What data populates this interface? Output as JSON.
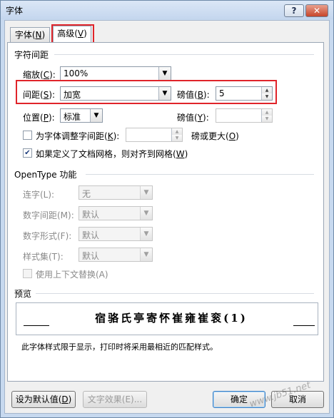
{
  "window": {
    "title": "字体",
    "help_label": "?",
    "close_label": "✕"
  },
  "tabs": [
    {
      "label": "字体(",
      "key": "N",
      "suffix": ")"
    },
    {
      "label": "高级(",
      "key": "V",
      "suffix": ")"
    }
  ],
  "spacing": {
    "section_title": "字符间距",
    "scale": {
      "label": "缩放(",
      "key": "C",
      "suffix": "):",
      "value": "100%"
    },
    "spacing": {
      "label": "间距(",
      "key": "S",
      "suffix": "):",
      "value": "加宽"
    },
    "spacing_by": {
      "label": "磅值(",
      "key": "B",
      "suffix": "):",
      "value": "5"
    },
    "position": {
      "label": "位置(",
      "key": "P",
      "suffix": "):",
      "value": "标准"
    },
    "position_by": {
      "label": "磅值(",
      "key": "Y",
      "suffix": "):",
      "value": ""
    },
    "kerning": {
      "label": "为字体调整字间距(",
      "key": "K",
      "suffix": "):",
      "value": "",
      "after_label": "磅或更大(",
      "after_key": "O",
      "after_suffix": ")",
      "checked": false
    },
    "snap_grid": {
      "label": "如果定义了文档网格，则对齐到网格(",
      "key": "W",
      "suffix": ")",
      "checked": true
    }
  },
  "opentype": {
    "section_title": "OpenType 功能",
    "ligatures": {
      "label": "连字(L):",
      "value": "无"
    },
    "number_spacing": {
      "label": "数字间距(M):",
      "value": "默认"
    },
    "number_forms": {
      "label": "数字形式(F):",
      "value": "默认"
    },
    "stylistic_sets": {
      "label": "样式集(T):",
      "value": "默认"
    },
    "contextual": {
      "label": "使用上下文替换(A)",
      "checked": false
    }
  },
  "preview": {
    "section_title": "预览",
    "sample": "宿骆氏亭寄怀崔雍崔衮(1)",
    "note": "此字体样式限于显示，打印时将采用最相近的匹配样式。"
  },
  "buttons": {
    "set_default": {
      "label": "设为默认值(",
      "key": "D",
      "suffix": ")"
    },
    "text_effects": "文字效果(E)...",
    "ok": "确定",
    "cancel": "取消"
  },
  "watermark": "www.jb51.net",
  "colors": {
    "highlight": "#e0242a",
    "window_frame": "#c7d9ef"
  }
}
